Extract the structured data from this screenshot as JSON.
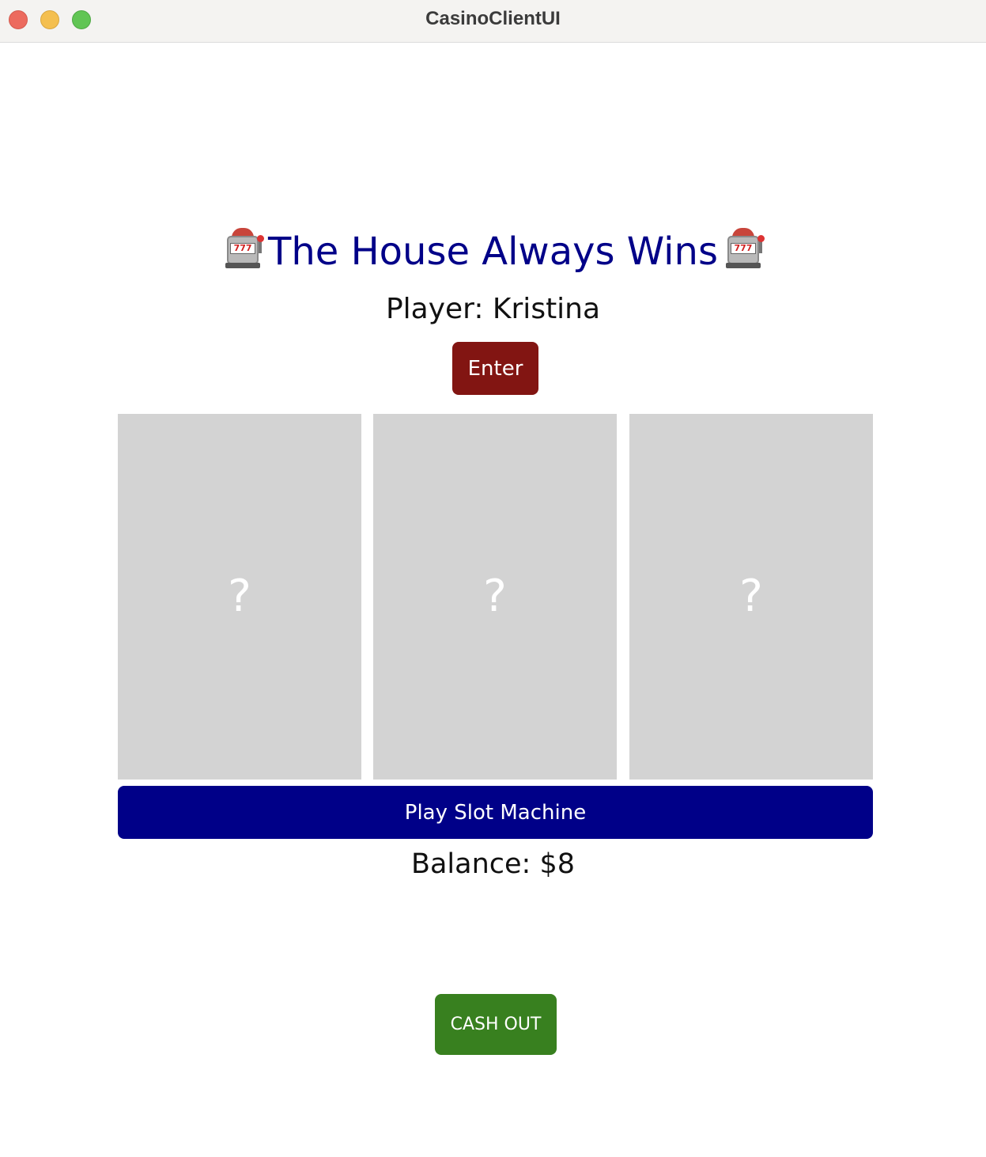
{
  "window": {
    "title": "CasinoClientUI"
  },
  "header": {
    "heading_text": "The House Always Wins",
    "heading_icon": "slot-machine-icon",
    "heading_color": "#000088"
  },
  "player": {
    "label": "Player: Kristina"
  },
  "enter_button": {
    "label": "Enter",
    "color": "#821512"
  },
  "reels": [
    {
      "symbol": "?"
    },
    {
      "symbol": "?"
    },
    {
      "symbol": "?"
    }
  ],
  "play_button": {
    "label": "Play Slot Machine",
    "color": "#000088"
  },
  "balance": {
    "label": "Balance: $8"
  },
  "cashout_button": {
    "label": "CASH OUT",
    "color": "#38801f"
  }
}
